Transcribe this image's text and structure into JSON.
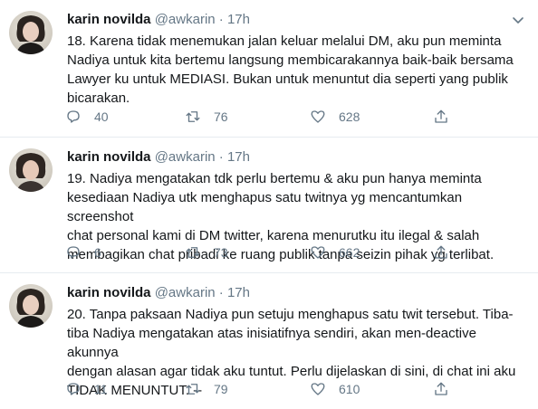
{
  "tweets": [
    {
      "name": "karin novilda",
      "handle": "@awkarin",
      "separator": "·",
      "time": "17h",
      "text": "18. Karena tidak menemukan jalan keluar melalui DM, aku pun meminta\nNadiya untuk kita bertemu langsung membicarakannya baik-baik bersama\nLawyer ku untuk MEDIASI.  Bukan untuk menuntut dia seperti yang publik\nbicarakan.",
      "replies": "40",
      "retweets": "76",
      "likes": "628"
    },
    {
      "name": "karin novilda",
      "handle": "@awkarin",
      "separator": "·",
      "time": "17h",
      "text": "19. Nadiya mengatakan tdk perlu bertemu & aku pun hanya meminta\nkesediaan Nadiya utk menghapus satu twitnya yg mencantumkan screenshot\nchat personal kami di DM twitter, karena menurutku itu ilegal & salah\nmembagikan chat pribadi ke ruang publik tanpa seizin pihak yg terlibat.",
      "replies": "6",
      "retweets": "73",
      "likes": "662"
    },
    {
      "name": "karin novilda",
      "handle": "@awkarin",
      "separator": "·",
      "time": "17h",
      "text": "20. Tanpa paksaan Nadiya pun setuju menghapus satu twit tersebut. Tiba-\ntiba Nadiya mengatakan atas inisiatifnya sendiri, akan men-deactive akunnya\ndengan alasan agar tidak aku tuntut. Perlu dijelaskan di sini, di chat ini aku\nTIDAK MENUNTUT. --",
      "replies": "11",
      "retweets": "79",
      "likes": "610"
    }
  ],
  "icons": {
    "reply": "reply-icon",
    "retweet": "retweet-icon",
    "like": "heart-icon",
    "share": "share-icon",
    "more": "chevron-down-icon"
  },
  "colors": {
    "text": "#14171a",
    "muted": "#657786",
    "divider": "#e6ecf0"
  }
}
